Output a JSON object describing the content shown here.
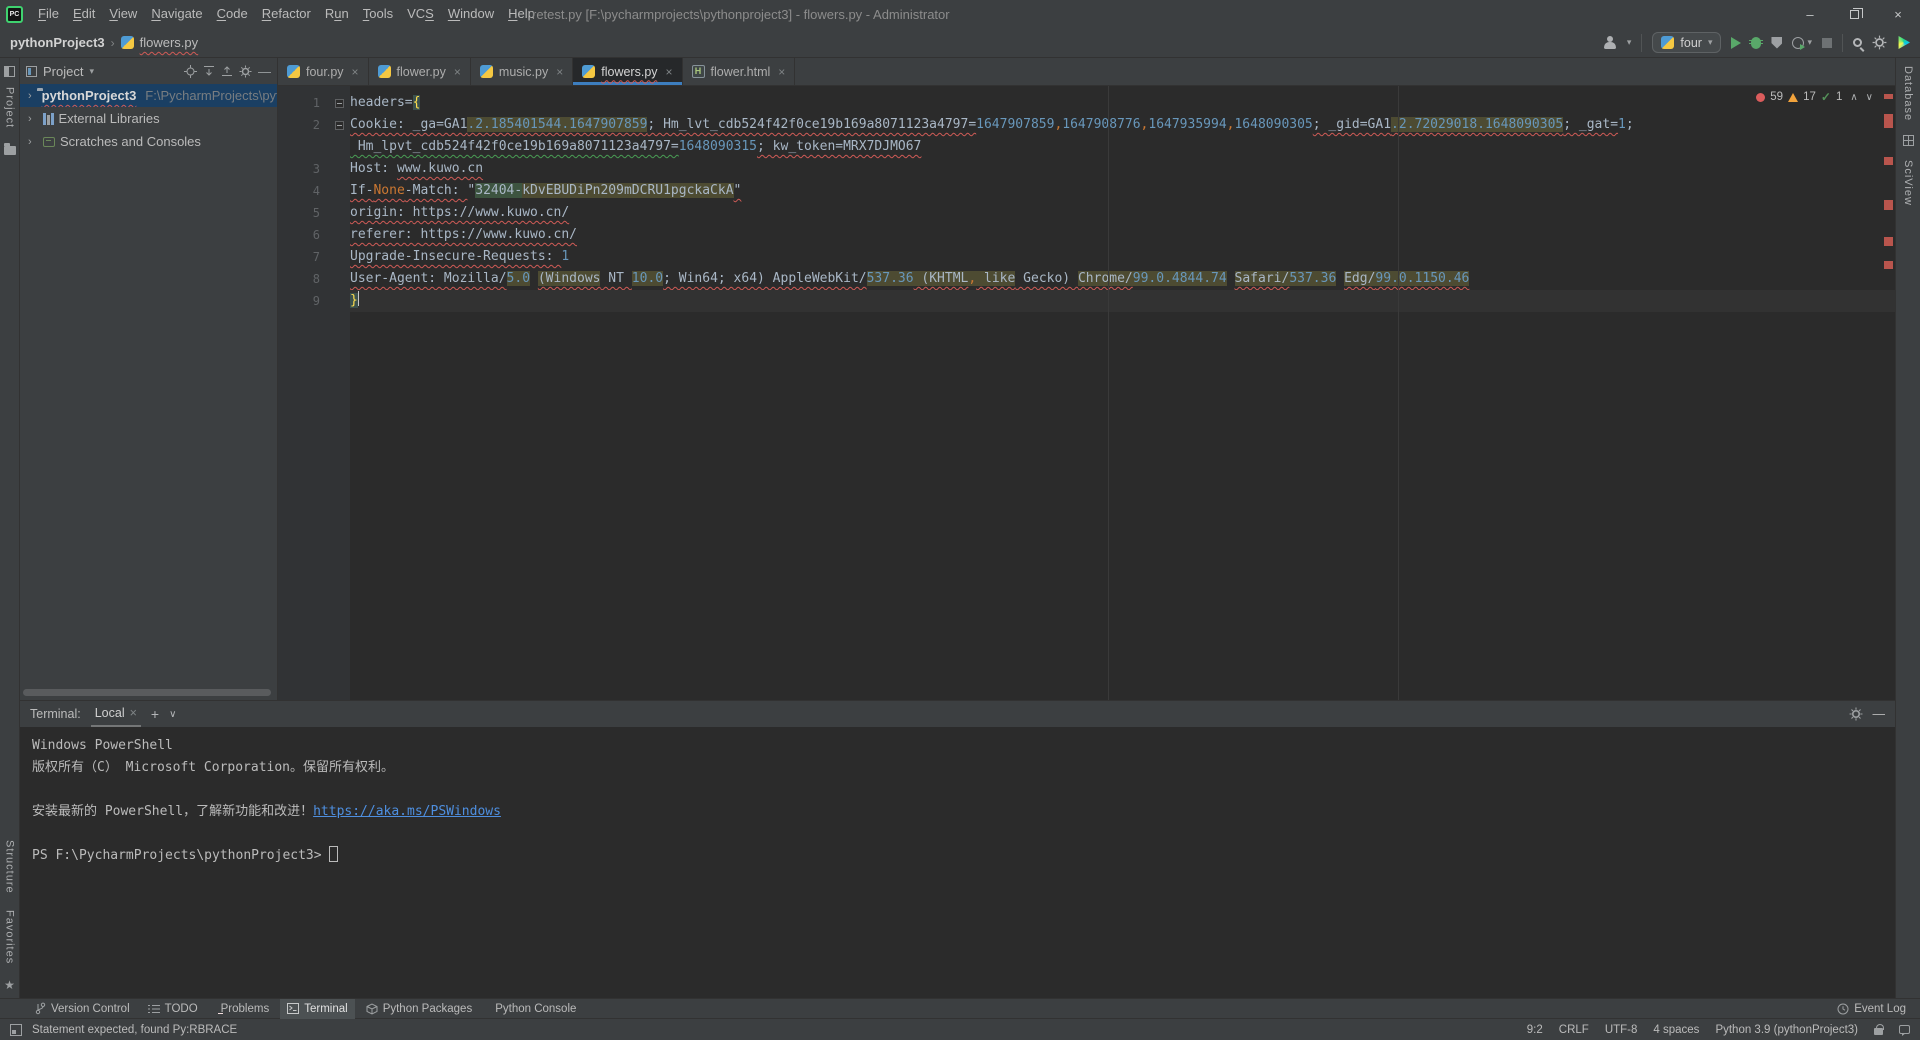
{
  "window": {
    "title": "retest.py [F:\\pycharmprojects\\pythonproject3] - flowers.py - Administrator"
  },
  "menu": {
    "items": [
      {
        "label": "File",
        "u": 0
      },
      {
        "label": "Edit",
        "u": 0
      },
      {
        "label": "View",
        "u": 0
      },
      {
        "label": "Navigate",
        "u": 0
      },
      {
        "label": "Code",
        "u": 0
      },
      {
        "label": "Refactor",
        "u": 0
      },
      {
        "label": "Run",
        "u": 1
      },
      {
        "label": "Tools",
        "u": 0
      },
      {
        "label": "VCS",
        "u": 2
      },
      {
        "label": "Window",
        "u": 0
      },
      {
        "label": "Help",
        "u": 0
      }
    ]
  },
  "breadcrumb": {
    "project": "pythonProject3",
    "file": "flowers.py"
  },
  "toolbar": {
    "run_config": "four"
  },
  "left_stripe": {
    "top_label": "Project",
    "bottom_labels": [
      "Structure",
      "Favorites"
    ]
  },
  "right_stripe": {
    "labels": [
      "Database",
      "SciView"
    ]
  },
  "project": {
    "header": "Project",
    "tree": [
      {
        "label": "pythonProject3",
        "path": "F:\\PycharmProjects\\pythonPro",
        "icon": "folder",
        "selected": true,
        "squiggle": true
      },
      {
        "label": "External Libraries",
        "icon": "libraries"
      },
      {
        "label": "Scratches and Consoles",
        "icon": "scratches"
      }
    ]
  },
  "editor_tabs": [
    {
      "label": "four.py",
      "icon": "python"
    },
    {
      "label": "flower.py",
      "icon": "python"
    },
    {
      "label": "music.py",
      "icon": "python"
    },
    {
      "label": "flowers.py",
      "icon": "python",
      "active": true,
      "squiggle": true
    },
    {
      "label": "flower.html",
      "icon": "html"
    }
  ],
  "editor": {
    "indicators": {
      "errors": "59",
      "warnings": "17",
      "ok": "1"
    },
    "lines": [
      {
        "num": "1",
        "fold": true,
        "segs": [
          {
            "t": "headers=",
            "c": ""
          },
          {
            "t": "{",
            "c": "brace"
          }
        ]
      },
      {
        "num": "2",
        "fold": true,
        "segs": [
          {
            "t": "Cookie: _ga=GA1",
            "c": "sq"
          },
          {
            "t": ".2.185401544.1647907859",
            "c": "num hl sq"
          },
          {
            "t": "; Hm_lvt_cdb524f42f0ce19b169a8071123a4797=",
            "c": "sq"
          },
          {
            "t": "1647907859",
            "c": "num"
          },
          {
            "t": ",",
            "c": "kw"
          },
          {
            "t": "1647908776",
            "c": "num"
          },
          {
            "t": ",",
            "c": "kw"
          },
          {
            "t": "1647935994",
            "c": "num"
          },
          {
            "t": ",",
            "c": "kw"
          },
          {
            "t": "1648090305",
            "c": "num"
          },
          {
            "t": "; _gid=GA1",
            "c": "sq"
          },
          {
            "t": ".2.72029018.1648090305",
            "c": "num hl sq"
          },
          {
            "t": "; _gat=",
            "c": "sq"
          },
          {
            "t": "1",
            "c": "num"
          },
          {
            "t": ";",
            "c": ""
          }
        ]
      },
      {
        "num": "",
        "segs": [
          {
            "t": " Hm_lpvt_cdb524f42f0ce19b169a8071123a4797=",
            "c": "sqg"
          },
          {
            "t": "1648090315",
            "c": "num"
          },
          {
            "t": "; kw_token=MRX7DJMO67",
            "c": "sq"
          }
        ]
      },
      {
        "num": "3",
        "segs": [
          {
            "t": "Host: ",
            "c": ""
          },
          {
            "t": "www.kuwo.cn",
            "c": "sq"
          }
        ]
      },
      {
        "num": "4",
        "segs": [
          {
            "t": "If-",
            "c": "sq"
          },
          {
            "t": "None",
            "c": "kw sq"
          },
          {
            "t": "-Match: ",
            "c": "sq"
          },
          {
            "t": "\"",
            "c": ""
          },
          {
            "t": "32404-",
            "c": "hlg"
          },
          {
            "t": "kDvEBUDiPn209mDCRU1pgckaCkA",
            "c": "hl"
          },
          {
            "t": "\"",
            "c": "sq"
          }
        ]
      },
      {
        "num": "5",
        "segs": [
          {
            "t": "origin: ",
            "c": "sq"
          },
          {
            "t": "https://www.kuwo.cn/",
            "c": "sq"
          }
        ]
      },
      {
        "num": "6",
        "segs": [
          {
            "t": "referer: ",
            "c": "sq"
          },
          {
            "t": "https://www.kuwo.cn/",
            "c": "sq"
          }
        ]
      },
      {
        "num": "7",
        "segs": [
          {
            "t": "Upgrade-Insecure-Requests: ",
            "c": "sq"
          },
          {
            "t": "1",
            "c": "num"
          }
        ]
      },
      {
        "num": "8",
        "segs": [
          {
            "t": "User-Agent: Mozilla/",
            "c": "sq"
          },
          {
            "t": "5.0",
            "c": "num hl"
          },
          {
            "t": " ",
            "c": ""
          },
          {
            "t": "(Windows",
            "c": "hl sq"
          },
          {
            "t": " NT ",
            "c": "sq"
          },
          {
            "t": "10.0",
            "c": "num hl"
          },
          {
            "t": "; Win64; x64) AppleWebKit/",
            "c": "sq"
          },
          {
            "t": "537.36",
            "c": "num hl"
          },
          {
            "t": " (KHTML",
            "c": "hl sq"
          },
          {
            "t": ",",
            "c": "kw hl"
          },
          {
            "t": " like",
            "c": "hl sq"
          },
          {
            "t": " Gecko) ",
            "c": "sq"
          },
          {
            "t": "Chrome/",
            "c": "hl sq"
          },
          {
            "t": "99.0.4844.74",
            "c": "num hl"
          },
          {
            "t": " ",
            "c": ""
          },
          {
            "t": "Safari/",
            "c": "hl sq"
          },
          {
            "t": "537.36",
            "c": "num hl"
          },
          {
            "t": " ",
            "c": ""
          },
          {
            "t": "Edg/",
            "c": "hl sq"
          },
          {
            "t": "99.0.1150.46",
            "c": "num hl sq"
          }
        ]
      },
      {
        "num": "9",
        "caret": true,
        "segs": [
          {
            "t": "}",
            "c": "brace"
          }
        ]
      }
    ]
  },
  "terminal": {
    "label": "Terminal:",
    "tab": "Local",
    "lines": [
      {
        "text": "Windows PowerShell"
      },
      {
        "text": "版权所有（C） Microsoft Corporation。保留所有权利。"
      },
      {
        "text": ""
      },
      {
        "text": "安装最新的 PowerShell，了解新功能和改进！",
        "link": "https://aka.ms/PSWindows"
      },
      {
        "text": ""
      },
      {
        "text": "PS F:\\PycharmProjects\\pythonProject3> ",
        "cursor": true
      }
    ]
  },
  "bottom_toolbar": {
    "buttons": [
      {
        "label": "Version Control",
        "icon": "branch-icon"
      },
      {
        "label": "TODO",
        "icon": "todo-icon"
      },
      {
        "label": "Problems",
        "icon": "problems-icon"
      },
      {
        "label": "Terminal",
        "icon": "terminal-icon",
        "active": true
      },
      {
        "label": "Python Packages",
        "icon": "packages-icon"
      },
      {
        "label": "Python Console",
        "icon": "python-icon"
      }
    ],
    "event_log": "Event Log"
  },
  "status": {
    "message": "Statement expected, found Py:RBRACE",
    "right": [
      {
        "name": "caret-position",
        "label": "9:2"
      },
      {
        "name": "line-separator",
        "label": "CRLF"
      },
      {
        "name": "encoding",
        "label": "UTF-8"
      },
      {
        "name": "indent",
        "label": "4 spaces"
      },
      {
        "name": "interpreter",
        "label": "Python 3.9 (pythonProject3)"
      }
    ]
  }
}
